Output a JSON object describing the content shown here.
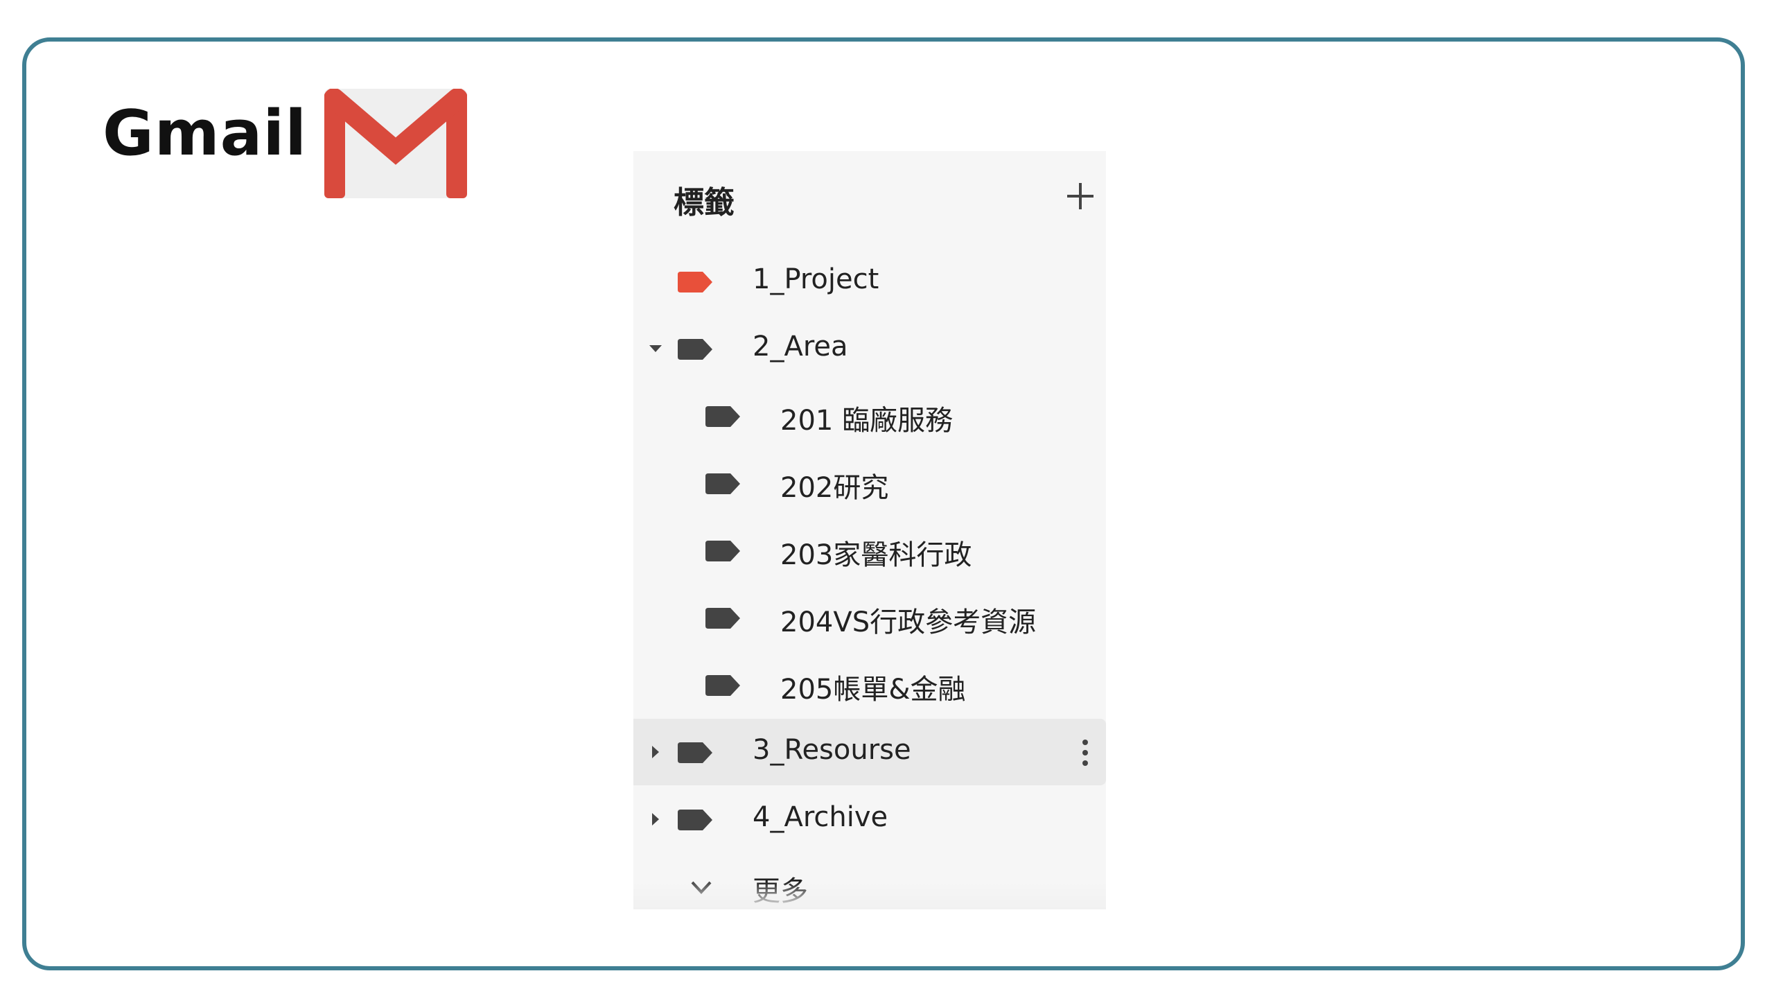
{
  "brand": {
    "title": "Gmail",
    "logo_icon": "gmail-envelope-logo",
    "logo_colors": {
      "red": "#d94a3d",
      "paper": "#efefef"
    }
  },
  "labels_panel": {
    "header": "標籤",
    "add_icon": "plus-icon",
    "items": [
      {
        "label": "1_Project",
        "color": "#e8503a",
        "level": 0,
        "expander": "none"
      },
      {
        "label": "2_Area",
        "color": "#444444",
        "level": 0,
        "expander": "expanded"
      },
      {
        "label": "201 臨廠服務",
        "color": "#444444",
        "level": 1,
        "expander": "none"
      },
      {
        "label": "202研究",
        "color": "#444444",
        "level": 1,
        "expander": "none"
      },
      {
        "label": "203家醫科行政",
        "color": "#444444",
        "level": 1,
        "expander": "none"
      },
      {
        "label": "204VS行政參考資源",
        "color": "#444444",
        "level": 1,
        "expander": "none"
      },
      {
        "label": "205帳單&金融",
        "color": "#444444",
        "level": 1,
        "expander": "none"
      },
      {
        "label": "3_Resourse",
        "color": "#444444",
        "level": 0,
        "expander": "collapsed",
        "hovered": true
      },
      {
        "label": "4_Archive",
        "color": "#444444",
        "level": 0,
        "expander": "collapsed"
      }
    ],
    "more": {
      "label": "更多",
      "icon": "chevron-down-icon"
    }
  }
}
